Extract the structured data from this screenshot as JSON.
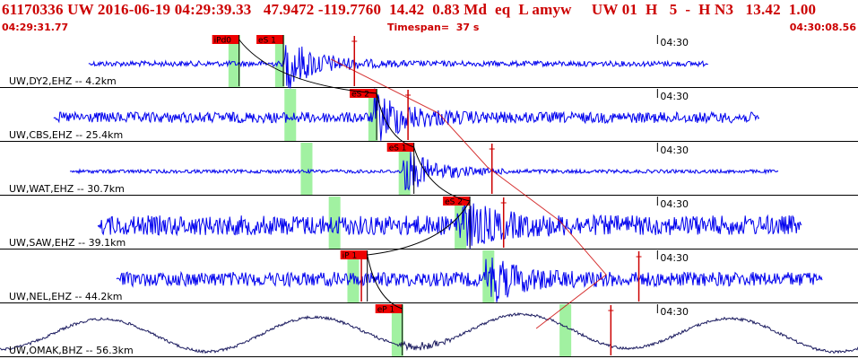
{
  "header": {
    "title": "61170336 UW 2016-06-19 04:29:39.33   47.9472 -119.7760  14.42  0.83 Md  eq  L amyw     UW 01  H   5  -  H N3   13.42  1.00",
    "start_time": "04:29:31.77",
    "timespan": "Timespan=  37 s",
    "end_time": "04:30:08.56"
  },
  "colors": {
    "title": "#cc0000",
    "trace": "#0000ee",
    "trace_lowfreq": "#1c1c60",
    "pick_box": "#ee0000",
    "window": "#90ee90",
    "grid": "#000000"
  },
  "time_axis": {
    "start_s": 0,
    "end_s": 36.8,
    "minute_mark_s": 28.2,
    "minute_label": "04:30"
  },
  "channels": [
    {
      "label": "UW,DY2,EHZ -- 4.2km",
      "type": "eq",
      "color": "trace",
      "signal": [
        3.8,
        30.4
      ],
      "onset": 12.2,
      "amp_noise": 3,
      "amp_peak": 30,
      "green": [
        [
          9.8,
          10.3
        ],
        [
          11.8,
          12.2
        ]
      ],
      "red": [
        15.2
      ],
      "picks": [
        {
          "label": "iPd0",
          "t": 9.1
        },
        {
          "label": "eS 1",
          "t": 11.0
        }
      ]
    },
    {
      "label": "UW,CBS,EHZ -- 25.4km",
      "type": "eq",
      "color": "trace",
      "signal": [
        2.3,
        32.6
      ],
      "onset": 16.0,
      "amp_noise": 6,
      "amp_peak": 28,
      "green": [
        [
          12.2,
          12.7
        ],
        [
          15.8,
          16.2
        ]
      ],
      "red": [
        17.5
      ],
      "picks": [
        {
          "label": "eS 2",
          "t": 15.0
        }
      ]
    },
    {
      "label": "UW,WAT,EHZ -- 30.7km",
      "type": "eq",
      "color": "trace",
      "signal": [
        3.0,
        33.4
      ],
      "onset": 17.3,
      "amp_noise": 2,
      "amp_peak": 26,
      "green": [
        [
          12.9,
          13.4
        ],
        [
          17.1,
          17.6
        ]
      ],
      "red": [
        21.1
      ],
      "picks": [
        {
          "label": "eS 1",
          "t": 16.6
        }
      ]
    },
    {
      "label": "UW,SAW,EHZ -- 39.1km",
      "type": "eq",
      "color": "trace",
      "signal": [
        4.2,
        34.4
      ],
      "onset": 19.6,
      "amp_noise": 11,
      "amp_peak": 26,
      "green": [
        [
          14.1,
          14.6
        ],
        [
          19.5,
          20.0
        ]
      ],
      "red": [
        21.6
      ],
      "picks": [
        {
          "label": "eS 2",
          "t": 19.0
        }
      ]
    },
    {
      "label": "UW,NEL,EHZ -- 44.2km",
      "type": "eq",
      "color": "trace",
      "signal": [
        5.0,
        35.3
      ],
      "onset": 20.8,
      "amp_noise": 8,
      "amp_peak": 26,
      "green": [
        [
          14.9,
          15.4
        ],
        [
          20.7,
          21.2
        ]
      ],
      "red": [
        15.5,
        27.4
      ],
      "picks": [
        {
          "label": "iP 1",
          "t": 14.6
        }
      ]
    },
    {
      "label": "UW,OMAK,BHZ -- 56.3km",
      "type": "lf",
      "color": "trace_lowfreq",
      "signal": [
        0.0,
        36.8
      ],
      "onset": 17.0,
      "amp_noise": 18,
      "amp_peak": 8,
      "green": [
        [
          16.8,
          17.3
        ],
        [
          24.0,
          24.5
        ]
      ],
      "red": [
        26.2
      ],
      "picks": [
        {
          "label": "eP 1",
          "t": 16.1
        }
      ]
    }
  ]
}
